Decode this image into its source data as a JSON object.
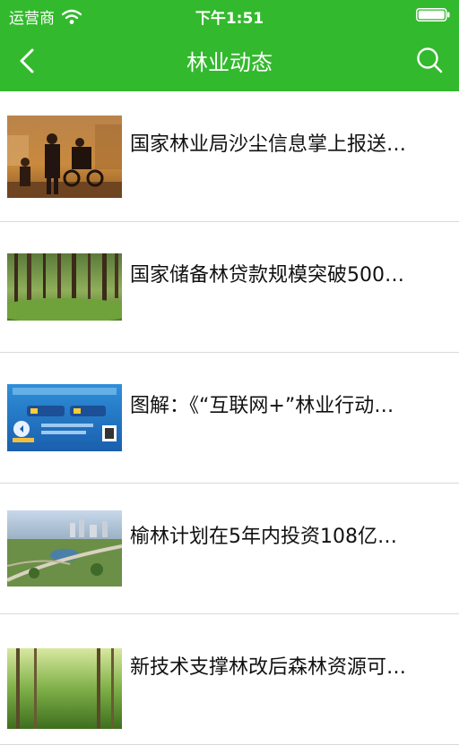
{
  "status_bar": {
    "carrier": "运营商",
    "time": "下午1:51"
  },
  "nav": {
    "title": "林业动态",
    "back_icon": "chevron-left-icon",
    "search_icon": "search-icon"
  },
  "colors": {
    "primary": "#33b92d",
    "divider": "#d9d9d9",
    "text": "#111111"
  },
  "news": [
    {
      "title": "国家林业局沙尘信息掌上报送…"
    },
    {
      "title": "国家储备林贷款规模突破500…"
    },
    {
      "title": "图解：《“互联网+”林业行动…"
    },
    {
      "title": "榆林计划在5年内投资108亿…"
    },
    {
      "title": "新技术支撑林改后森林资源可…"
    }
  ]
}
